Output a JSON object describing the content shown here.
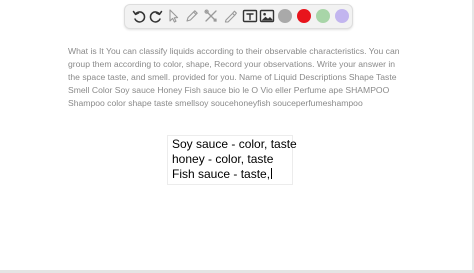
{
  "toolbar": {
    "tools": [
      {
        "icon": "undo-icon"
      },
      {
        "icon": "redo-icon"
      },
      {
        "icon": "pointer-icon"
      },
      {
        "icon": "pen-icon"
      },
      {
        "icon": "tools-icon"
      },
      {
        "icon": "highlighter-icon"
      },
      {
        "icon": "text-box-icon"
      },
      {
        "icon": "image-icon"
      }
    ],
    "colors": [
      "#a9a9a9",
      "#e8141c",
      "#a8d5a8",
      "#c2b5ef"
    ]
  },
  "question": {
    "text": "What is It You can classify liquids according to their observable characteristics. You can group them according to color, shape, Record your observations. Write your answer in the space taste, and smell. provided for you. Name of Liquid Descriptions Shape Taste Smell Color Soy sauce Honey Fish sauce bio le O Vio eller Perfume ape SHAMPOO Shampoo color shape taste smellsoy soucehoneyfish souceperfumeshampoo"
  },
  "answer": {
    "lines": [
      "Soy sauce - color, taste",
      "honey - color, taste",
      "Fish sauce - taste,"
    ]
  }
}
